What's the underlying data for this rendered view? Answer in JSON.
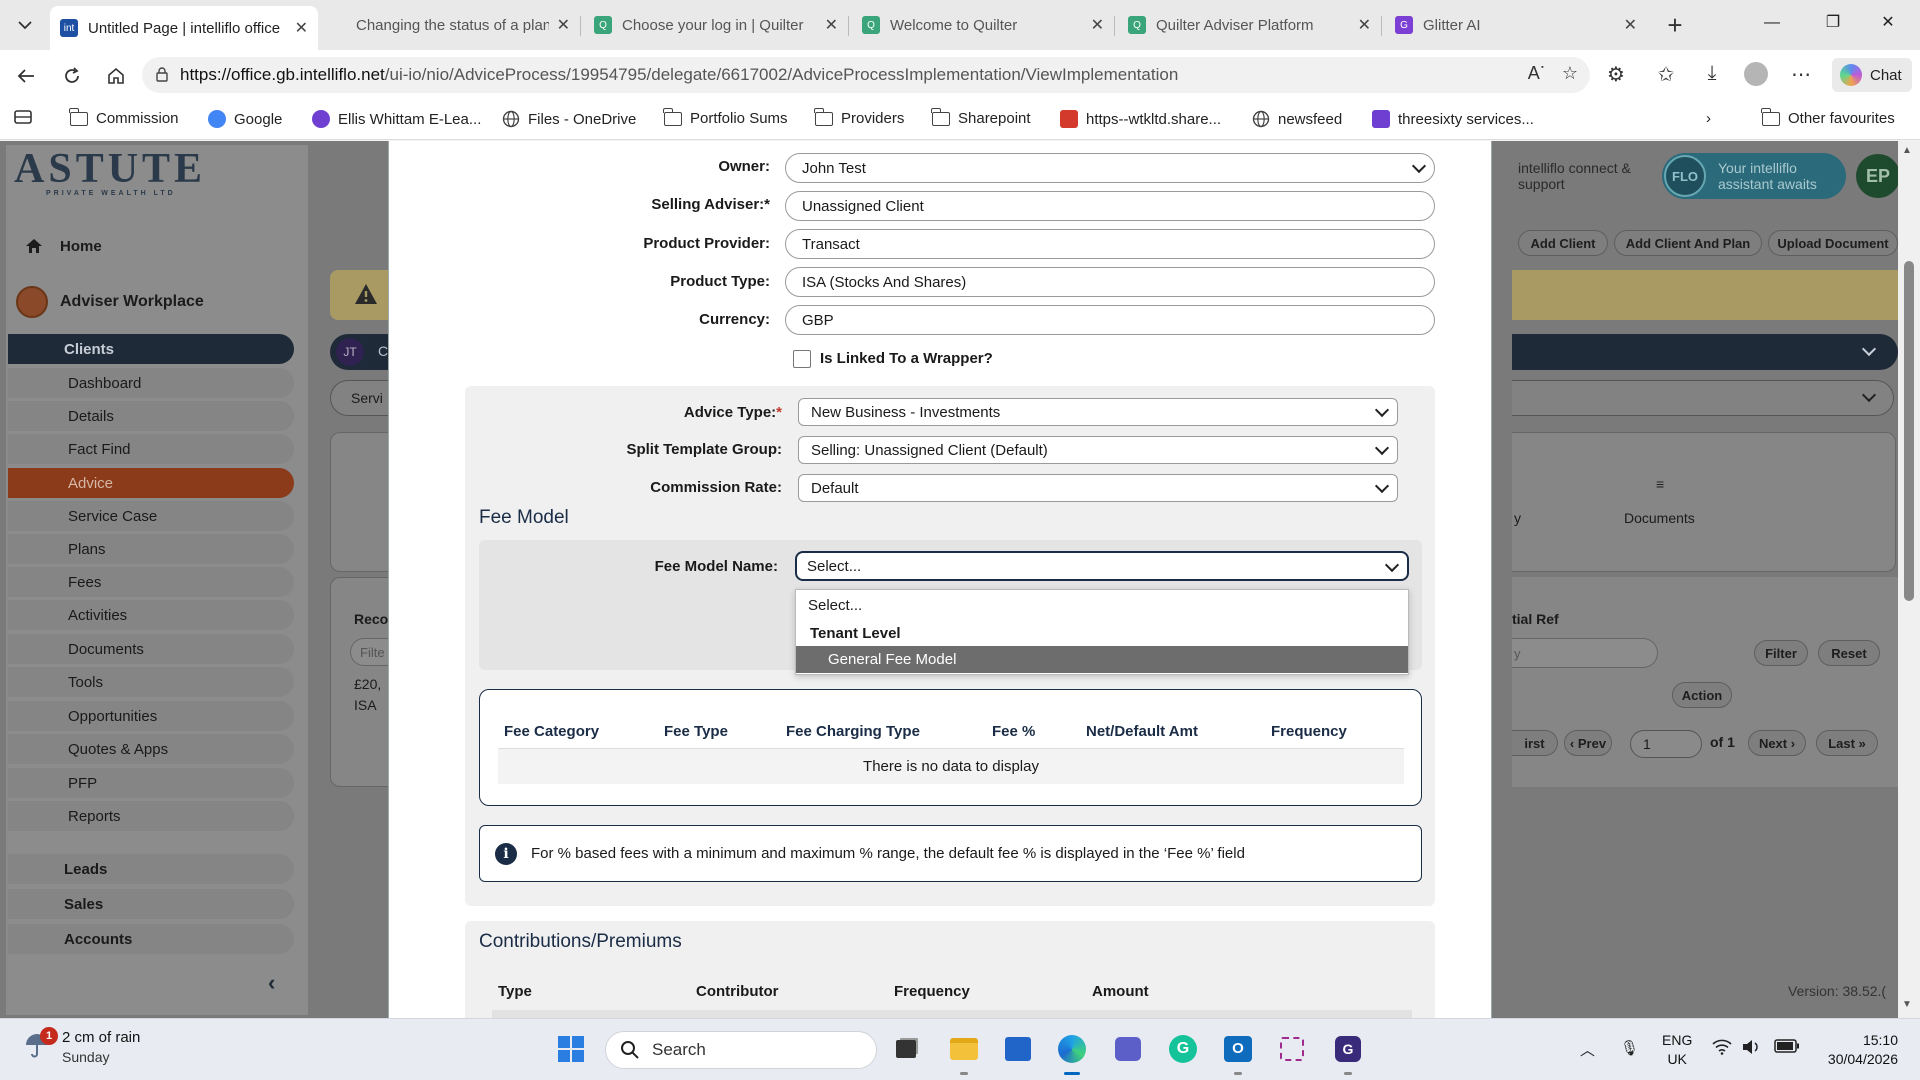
{
  "browser": {
    "tabs": [
      {
        "title": "Untitled Page | intelliflo office",
        "active": true,
        "fav_color": "#1d4fa3",
        "fav_text": "int"
      },
      {
        "title": "Changing the status of a plan",
        "active": false,
        "fav_color": "#444444",
        "fav_text": ""
      },
      {
        "title": "Choose your log in | Quilter",
        "active": false,
        "fav_color": "#3aa57a",
        "fav_text": "Q"
      },
      {
        "title": "Welcome to Quilter",
        "active": false,
        "fav_color": "#3aa57a",
        "fav_text": "Q"
      },
      {
        "title": "Quilter Adviser Platform",
        "active": false,
        "fav_color": "#3aa57a",
        "fav_text": "Q"
      },
      {
        "title": "Glitter AI",
        "active": false,
        "fav_color": "#7b3fd4",
        "fav_text": "G"
      }
    ],
    "url_host": "https://office.gb.intelliflo.net",
    "url_path": "/ui-io/nio/AdviceProcess/19954795/delegate/6617002/AdviceProcessImplementation/ViewImplementation",
    "chat_label": "Chat",
    "bookmarks": [
      {
        "label": "Commission",
        "icon": "folder-icon"
      },
      {
        "label": "Google",
        "icon": "google-icon"
      },
      {
        "label": "Ellis Whittam E-Lea...",
        "icon": "site-icon"
      },
      {
        "label": "Files - OneDrive",
        "icon": "globe-icon"
      },
      {
        "label": "Portfolio Sums",
        "icon": "folder-icon"
      },
      {
        "label": "Providers",
        "icon": "folder-icon"
      },
      {
        "label": "Sharepoint",
        "icon": "folder-icon"
      },
      {
        "label": "https--wtkltd.share...",
        "icon": "pdf-icon"
      },
      {
        "label": "newsfeed",
        "icon": "globe-icon"
      },
      {
        "label": "threesixty services...",
        "icon": "site-icon"
      }
    ],
    "other_favourites": "Other favourites"
  },
  "app": {
    "logo_main": "ASTUTE",
    "logo_sub": "PRIVATE WEALTH LTD",
    "home": "Home",
    "adviser_workplace": "Adviser Workplace",
    "nav": [
      {
        "label": "Clients",
        "kind": "top",
        "state": "clients"
      },
      {
        "label": "Dashboard",
        "kind": "sub",
        "state": ""
      },
      {
        "label": "Details",
        "kind": "sub",
        "state": ""
      },
      {
        "label": "Fact Find",
        "kind": "sub",
        "state": ""
      },
      {
        "label": "Advice",
        "kind": "sub",
        "state": "advice"
      },
      {
        "label": "Service Case",
        "kind": "sub",
        "state": ""
      },
      {
        "label": "Plans",
        "kind": "sub",
        "state": ""
      },
      {
        "label": "Fees",
        "kind": "sub",
        "state": ""
      },
      {
        "label": "Activities",
        "kind": "sub",
        "state": ""
      },
      {
        "label": "Documents",
        "kind": "sub",
        "state": ""
      },
      {
        "label": "Tools",
        "kind": "sub",
        "state": ""
      },
      {
        "label": "Opportunities",
        "kind": "sub",
        "state": ""
      },
      {
        "label": "Quotes & Apps",
        "kind": "sub",
        "state": ""
      },
      {
        "label": "PFP",
        "kind": "sub",
        "state": ""
      },
      {
        "label": "Reports",
        "kind": "sub",
        "state": ""
      },
      {
        "label": "Leads",
        "kind": "top",
        "state": ""
      },
      {
        "label": "Sales",
        "kind": "top",
        "state": ""
      },
      {
        "label": "Accounts",
        "kind": "top",
        "state": ""
      }
    ],
    "header_connect": "intelliflo connect & support",
    "flo_text": "Your intelliflo assistant awaits",
    "flo_badge": "FLO",
    "user_initials": "EP",
    "actions": [
      "Add Client",
      "Add Client And Plan",
      "Upload Document"
    ],
    "client_initials": "JT",
    "client_partial": "C",
    "service_partial": "Servi",
    "documents_tab": "Documents",
    "partial_tab": "y",
    "rec_partial": "Reco",
    "filter_partial": "Filte",
    "amount_partial": "£20,",
    "isa_partial": "ISA",
    "ref_partial": "tial Ref",
    "ref_input_partial": "y",
    "filter_btn": "Filter",
    "reset_btn": "Reset",
    "action_btn": "Action",
    "pager": {
      "first": "irst",
      "prev": "‹ Prev",
      "page": "1",
      "of": "of 1",
      "next": "Next ›",
      "last": "Last »"
    },
    "version": "Version: 38.52.("
  },
  "modal": {
    "owner_label": "Owner:",
    "owner_value": "John Test",
    "selling_adviser_label": "Selling Adviser:*",
    "selling_adviser_value": "Unassigned Client",
    "product_provider_label": "Product Provider:",
    "product_provider_value": "Transact",
    "product_type_label": "Product Type:",
    "product_type_value": "ISA (Stocks And Shares)",
    "currency_label": "Currency:",
    "currency_value": "GBP",
    "linked_wrapper_label": "Is Linked To a Wrapper?",
    "advice_type_label": "Advice Type:",
    "advice_type_req": "*",
    "advice_type_value": "New Business - Investments",
    "split_template_label": "Split Template Group:",
    "split_template_value": "Selling: Unassigned Client (Default)",
    "commission_rate_label": "Commission Rate:",
    "commission_rate_value": "Default",
    "fee_model_title": "Fee Model",
    "fee_model_name_label": "Fee Model Name:",
    "fee_model_name_value": "Select...",
    "dropdown": {
      "placeholder": "Select...",
      "group": "Tenant Level",
      "option": "General Fee Model"
    },
    "fee_table": {
      "headers": [
        "Fee Category",
        "Fee Type",
        "Fee Charging Type",
        "Fee %",
        "Net/Default Amt",
        "Frequency"
      ],
      "empty": "There is no data to display"
    },
    "info_text": "For % based fees with a minimum and maximum % range, the default fee % is displayed in the ‘Fee %’ field",
    "contributions_title": "Contributions/Premiums",
    "contrib_headers": [
      "Type",
      "Contributor",
      "Frequency",
      "Amount"
    ]
  },
  "taskbar": {
    "weather_badge": "1",
    "weather_line1": "2 cm of rain",
    "weather_line2": "Sunday",
    "search_label": "Search",
    "lang_line1": "ENG",
    "lang_line2": "UK",
    "time": "15:10",
    "date": "30/04/2026"
  }
}
